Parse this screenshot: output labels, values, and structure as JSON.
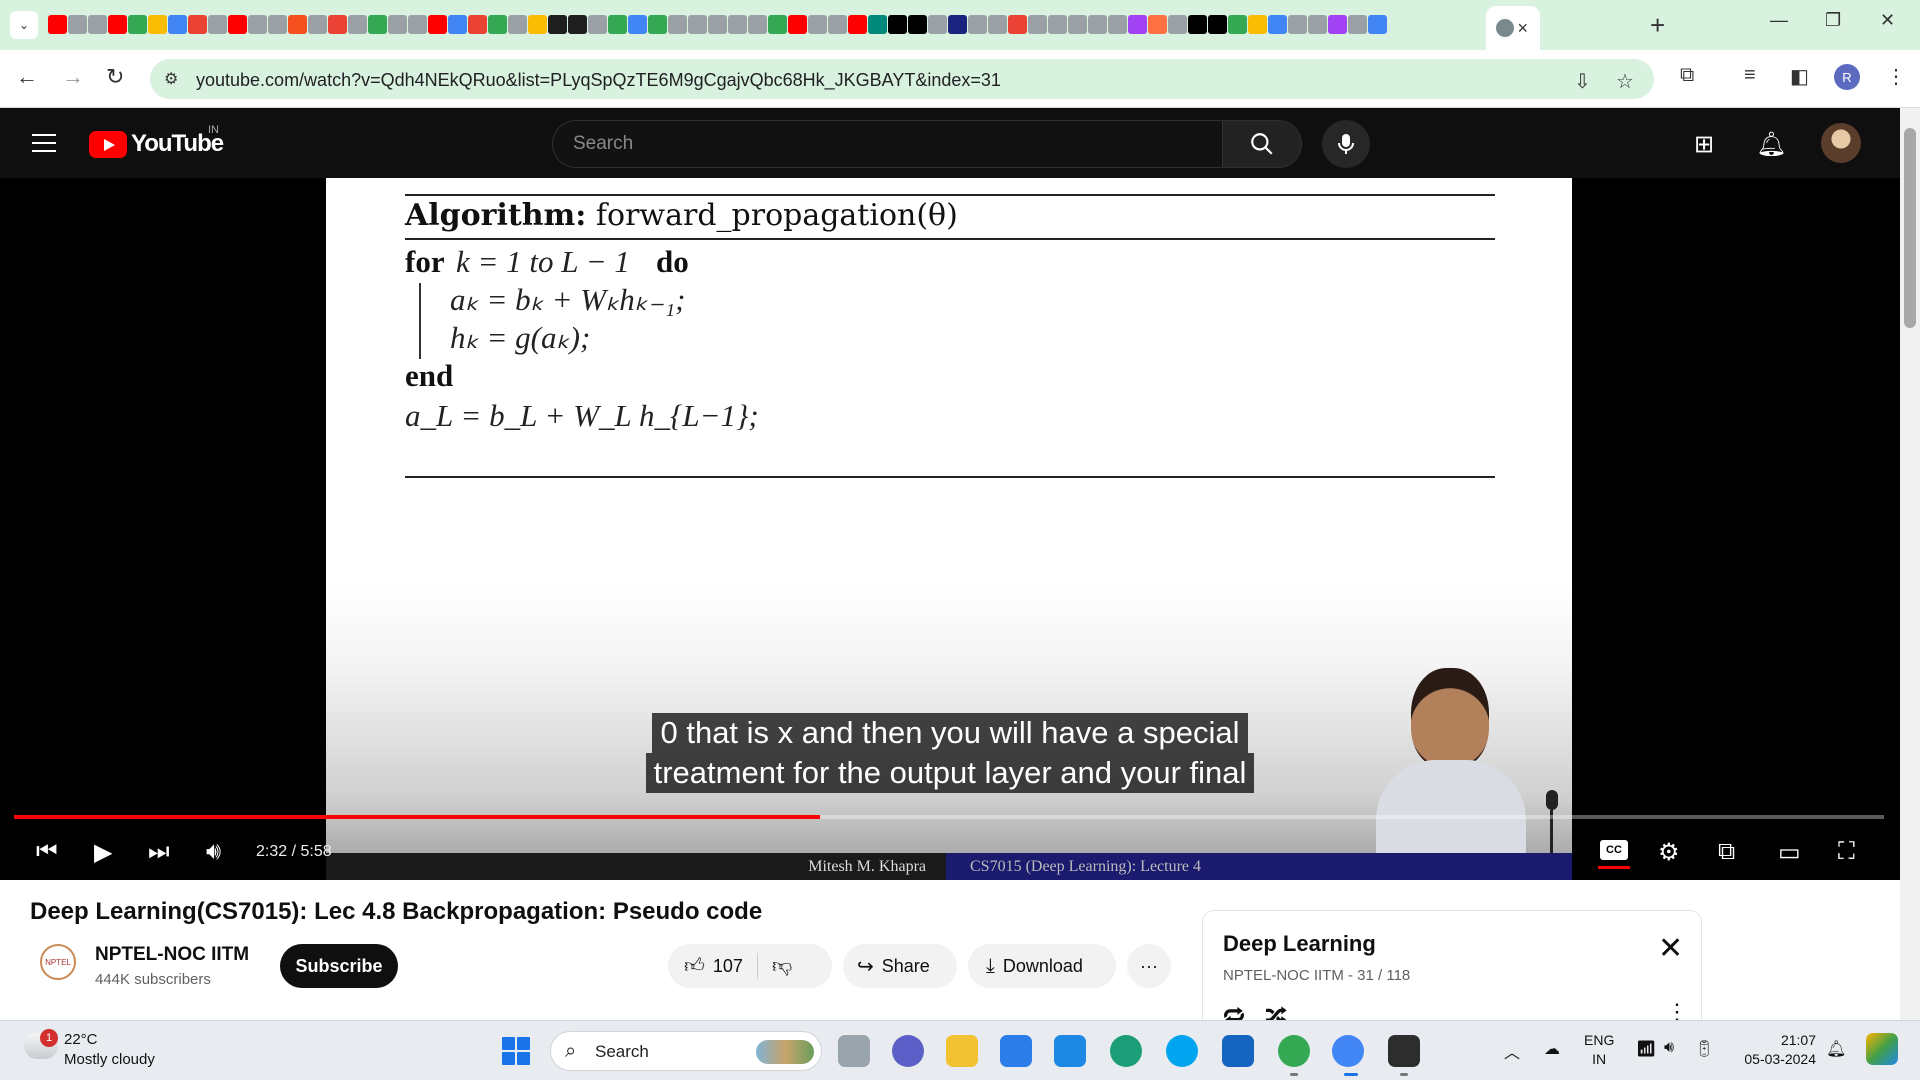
{
  "browser": {
    "tab_close_label": "×",
    "new_tab_label": "+",
    "url": "youtube.com/watch?v=Qdh4NEkQRuo&list=PLyqSpQzTE6M9gCgajvQbc68Hk_JKGBAYT&index=31",
    "profile_initial": "R",
    "tab_favicon_colors": [
      "#ff0000",
      "#9aa0a6",
      "#9aa0a6",
      "#ff0000",
      "#34a853",
      "#fbbc04",
      "#4285f4",
      "#ea4335",
      "#9aa0a6",
      "#ff0000",
      "#9aa0a6",
      "#9aa0a6",
      "#f4511e",
      "#9aa0a6",
      "#ea4335",
      "#9aa0a6",
      "#34a853",
      "#9aa0a6",
      "#9aa0a6",
      "#ff0000",
      "#4285f4",
      "#ea4335",
      "#34a853",
      "#9aa0a6",
      "#fbbc04",
      "#1e1e1e",
      "#1e1e1e",
      "#9aa0a6",
      "#34a853",
      "#4285f4",
      "#34a853",
      "#9aa0a6",
      "#9aa0a6",
      "#9aa0a6",
      "#9aa0a6",
      "#9aa0a6",
      "#34a853",
      "#ff0000",
      "#9aa0a6",
      "#9aa0a6",
      "#ff0000",
      "#00897b",
      "#000000",
      "#000000",
      "#9aa0a6",
      "#1a237e",
      "#9aa0a6",
      "#9aa0a6",
      "#ea4335",
      "#9aa0a6",
      "#9aa0a6",
      "#9aa0a6",
      "#9aa0a6",
      "#9aa0a6",
      "#a142f4",
      "#ff7043",
      "#9aa0a6",
      "#000000",
      "#000000",
      "#34a853",
      "#fbbc04",
      "#4285f4",
      "#9aa0a6",
      "#9aa0a6",
      "#a142f4",
      "#9aa0a6",
      "#4285f4"
    ]
  },
  "youtube": {
    "logo_text": "YouTube",
    "country": "IN",
    "search_placeholder": "Search"
  },
  "video": {
    "slide": {
      "algo_label": "Algorithm:",
      "algo_name": "forward_propagation(θ)",
      "for_kw": "for",
      "for_range": "k = 1  to  L − 1",
      "do_kw": "do",
      "line1": "aₖ = bₖ + Wₖhₖ₋₁;",
      "line2": "hₖ = g(aₖ);",
      "end_kw": "end",
      "line3": "a_L = b_L + W_L h_{L−1};",
      "footer_left": "Mitesh M. Khapra",
      "footer_right": "CS7015 (Deep Learning): Lecture 4"
    },
    "caption_line1": "0 that is x and then you will have a special",
    "caption_line2": "treatment for the output layer and your final",
    "time_display": "2:32 / 5:58",
    "progress_fraction": 0.431,
    "cc_label": "CC",
    "title": "Deep Learning(CS7015): Lec 4.8 Backpropagation: Pseudo code",
    "channel_name": "NPTEL-NOC IITM",
    "channel_avatar_text": "NPTEL",
    "subscribers": "444K subscribers",
    "subscribe_label": "Subscribe",
    "like_count": "107",
    "share_label": "Share",
    "download_label": "Download",
    "more_label": "···"
  },
  "playlist": {
    "title": "Deep Learning",
    "subtitle": "NPTEL-NOC IITM - 31 / 118"
  },
  "taskbar": {
    "notification_count": "1",
    "temperature": "22°C",
    "condition": "Mostly cloudy",
    "search_label": "Search",
    "lang_line1": "ENG",
    "lang_line2": "IN",
    "time": "21:07",
    "date": "05-03-2024"
  }
}
